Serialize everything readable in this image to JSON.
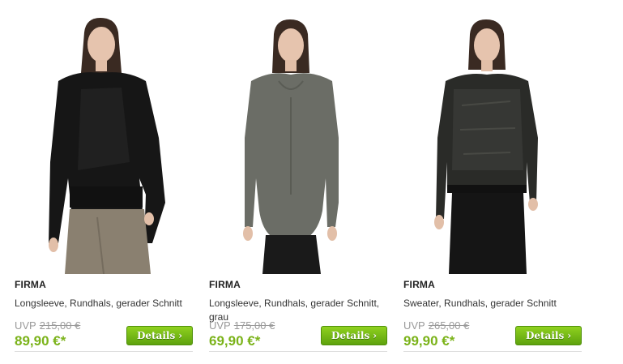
{
  "products": [
    {
      "brand": "FIRMA",
      "title": "Longsleeve, Rundhals, gerader Schnitt",
      "uvp_label": "UVP",
      "uvp_price": "215,00 €",
      "price": "89,90 €*",
      "details_label": "Details",
      "top_color": "#1a1a1a",
      "pants_color": "#8a8070"
    },
    {
      "brand": "FIRMA",
      "title": "Longsleeve, Rundhals, gerader Schnitt, grau",
      "uvp_label": "UVP",
      "uvp_price": "175,00 €",
      "price": "69,90 €*",
      "details_label": "Details",
      "top_color": "#6b6d66",
      "pants_color": "#1a1a1a"
    },
    {
      "brand": "FIRMA",
      "title": "Sweater, Rundhals, gerader Schnitt",
      "uvp_label": "UVP",
      "uvp_price": "265,00 €",
      "price": "99,90 €*",
      "details_label": "Details",
      "top_color": "#2a2b28",
      "pants_color": "#151515"
    }
  ],
  "colors": {
    "accent_green": "#7bb31a",
    "button_green": "#6cb514",
    "strike_gray": "#9a9a9a"
  },
  "icons": {
    "details_chevron": "chevron-right-icon"
  }
}
